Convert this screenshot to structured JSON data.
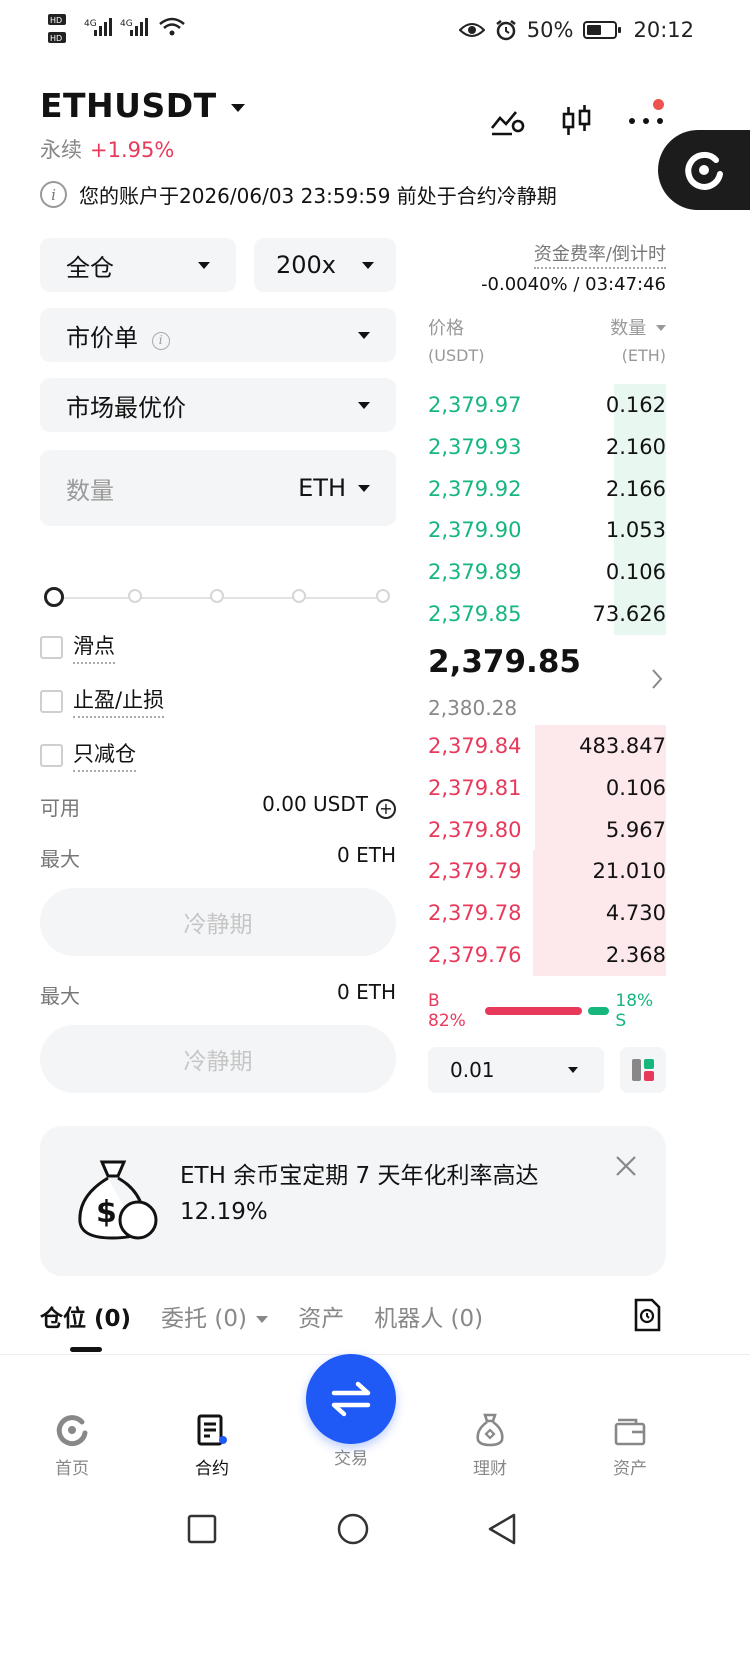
{
  "status_bar": {
    "left_icons": [
      "HD",
      "HD",
      "4G",
      "4G",
      "wifi"
    ],
    "battery": "50%",
    "time": "20:12"
  },
  "header": {
    "pair": "ETHUSDT",
    "contract_type": "永续",
    "change": "+1.95%"
  },
  "notice": {
    "text": "您的账户于2026/06/03 23:59:59 前处于合约冷静期"
  },
  "order_form": {
    "margin_mode": "全仓",
    "leverage": "200x",
    "order_type": "市价单",
    "price_type": "市场最优价",
    "quantity_placeholder": "数量",
    "quantity_unit": "ETH",
    "slider_percent": 0,
    "options": [
      "滑点",
      "止盈/止损",
      "只减仓"
    ],
    "available_label": "可用",
    "available_value": "0.00 USDT",
    "max_label_1": "最大",
    "max_value_1": "0 ETH",
    "button_1": "冷静期",
    "max_label_2": "最大",
    "max_value_2": "0 ETH",
    "button_2": "冷静期"
  },
  "funding": {
    "label": "资金费率/倒计时",
    "value": "-0.0040% / 03:47:46"
  },
  "orderbook": {
    "price_header": "价格",
    "price_unit": "(USDT)",
    "qty_header": "数量",
    "qty_unit": "(ETH)",
    "asks": [
      {
        "price": "2,379.97",
        "qty": "0.162",
        "depth": 0.22
      },
      {
        "price": "2,379.93",
        "qty": "2.160",
        "depth": 0.22
      },
      {
        "price": "2,379.92",
        "qty": "2.166",
        "depth": 0.22
      },
      {
        "price": "2,379.90",
        "qty": "1.053",
        "depth": 0.22
      },
      {
        "price": "2,379.89",
        "qty": "0.106",
        "depth": 0.22
      },
      {
        "price": "2,379.85",
        "qty": "73.626",
        "depth": 0.22
      }
    ],
    "last_price": "2,379.85",
    "mark_price": "2,380.28",
    "bids": [
      {
        "price": "2,379.84",
        "qty": "483.847",
        "depth": 0.55
      },
      {
        "price": "2,379.81",
        "qty": "0.106",
        "depth": 0.55
      },
      {
        "price": "2,379.80",
        "qty": "5.967",
        "depth": 0.55
      },
      {
        "price": "2,379.79",
        "qty": "21.010",
        "depth": 0.56
      },
      {
        "price": "2,379.78",
        "qty": "4.730",
        "depth": 0.56
      },
      {
        "price": "2,379.76",
        "qty": "2.368",
        "depth": 0.56
      }
    ],
    "buy_ratio": "B 82%",
    "sell_ratio": "18% S",
    "buy_fraction": 0.82,
    "precision": "0.01"
  },
  "banner": {
    "text": "ETH 余币宝定期 7 天年化利率高达 12.19%"
  },
  "tabs": [
    {
      "label": "仓位 (0)",
      "active": true
    },
    {
      "label": "委托 (0)",
      "active": false
    },
    {
      "label": "资产",
      "active": false
    },
    {
      "label": "机器人 (0)",
      "active": false
    }
  ],
  "bottom_nav": [
    {
      "label": "首页",
      "icon": "home-icon"
    },
    {
      "label": "合约",
      "icon": "futures-icon"
    },
    {
      "label": "交易",
      "icon": "swap-icon"
    },
    {
      "label": "理财",
      "icon": "finance-icon"
    },
    {
      "label": "资产",
      "icon": "wallet-icon"
    }
  ],
  "colors": {
    "buy_green": "#16b67d",
    "sell_red": "#e8395b",
    "brand_blue": "#1f5af6"
  }
}
